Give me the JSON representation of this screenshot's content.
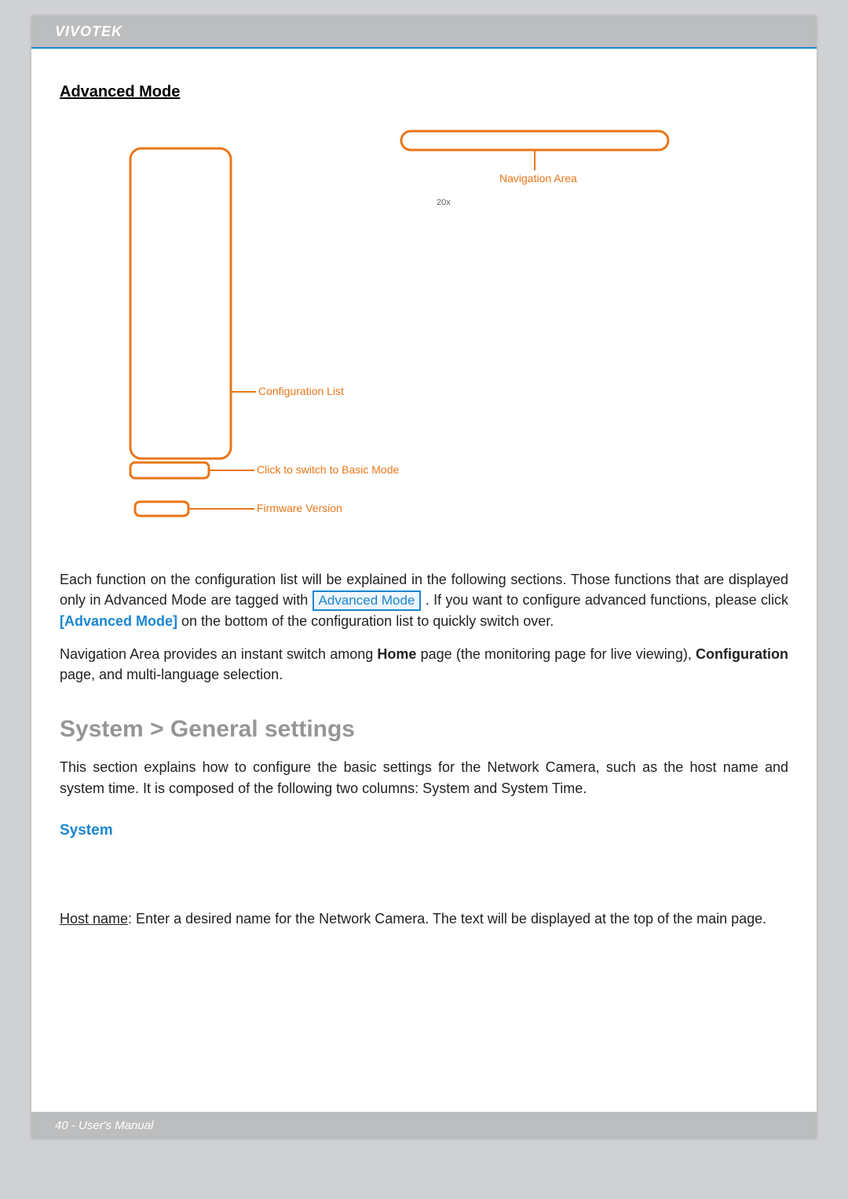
{
  "brand": "VIVOTEK",
  "section_title": "Advanced Mode",
  "diagram": {
    "nav_area": "Navigation Area",
    "zoom": "20x",
    "config_list": "Configuration List",
    "switch_basic": "Click to switch to Basic Mode",
    "firmware": "Firmware Version"
  },
  "para1": {
    "lead": "Each function on the configuration list will be explained in the following sections. Those functions that are displayed only in Advanced Mode are tagged with ",
    "tag": "Advanced Mode",
    "mid": " . If you want to configure advanced functions, please click ",
    "link": "[Advanced Mode]",
    "tail": " on the bottom of the configuration list to quickly switch over."
  },
  "para2": {
    "lead": "Navigation Area provides an instant switch among ",
    "home": "Home",
    "mid": " page (the monitoring page for live viewing), ",
    "conf": "Configuration",
    "tail": " page, and multi-language selection."
  },
  "h2": "System > General settings",
  "para3": "This section explains how to configure the basic settings for the Network Camera, such as the host name and system time. It is composed of the following two columns: System and System Time.",
  "h3": "System",
  "host": {
    "label": "Host name",
    "text": ": Enter a desired name for the Network Camera. The text will be displayed at the top of the main page."
  },
  "footer": "40 - User's Manual"
}
